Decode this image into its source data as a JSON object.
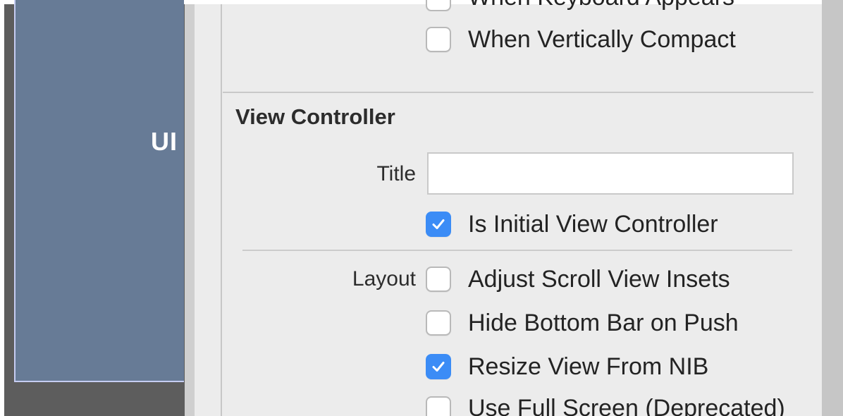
{
  "canvas": {
    "view_controller_label": "UI"
  },
  "inspector": {
    "top_options": [
      {
        "label": "When Keyboard Appears",
        "checked": false
      },
      {
        "label": "When Vertically Compact",
        "checked": false
      }
    ],
    "view_controller_section": {
      "title": "View Controller",
      "title_field": {
        "label": "Title",
        "value": "",
        "placeholder": ""
      },
      "is_initial": {
        "label": "Is Initial View Controller",
        "checked": true
      },
      "layout_label": "Layout",
      "layout_options": [
        {
          "label": "Adjust Scroll View Insets",
          "checked": false
        },
        {
          "label": "Hide Bottom Bar on Push",
          "checked": false
        },
        {
          "label": "Resize View From NIB",
          "checked": true
        },
        {
          "label": "Use Full Screen (Deprecated)",
          "checked": false
        }
      ]
    }
  },
  "colors": {
    "accent": "#3b8cf6",
    "view_fill": "#677b96",
    "canvas_bg": "#5d5d5d",
    "inspector_bg": "#ececec"
  }
}
